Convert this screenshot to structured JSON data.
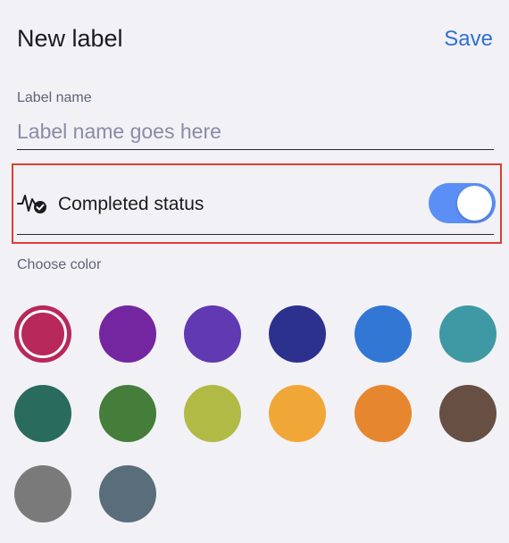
{
  "header": {
    "title": "New label",
    "save_label": "Save"
  },
  "label_name": {
    "label": "Label name",
    "value": "",
    "placeholder": "Label name goes here"
  },
  "completed_status": {
    "label": "Completed status",
    "enabled": true,
    "icon": "activity-check-icon"
  },
  "colors": {
    "label": "Choose color",
    "selected_index": 0,
    "swatches": [
      {
        "name": "crimson",
        "hex": "#b8285a"
      },
      {
        "name": "purple",
        "hex": "#7426a0"
      },
      {
        "name": "violet",
        "hex": "#6039b3"
      },
      {
        "name": "indigo",
        "hex": "#2c318e"
      },
      {
        "name": "blue",
        "hex": "#3277d3"
      },
      {
        "name": "teal",
        "hex": "#3f99a4"
      },
      {
        "name": "dark-green",
        "hex": "#296b5d"
      },
      {
        "name": "green",
        "hex": "#447e3a"
      },
      {
        "name": "olive",
        "hex": "#b1ba45"
      },
      {
        "name": "amber",
        "hex": "#f1a737"
      },
      {
        "name": "orange",
        "hex": "#e6862f"
      },
      {
        "name": "brown",
        "hex": "#674f43"
      },
      {
        "name": "gray",
        "hex": "#7a7a7a"
      },
      {
        "name": "slate",
        "hex": "#5a6d7a"
      }
    ]
  }
}
